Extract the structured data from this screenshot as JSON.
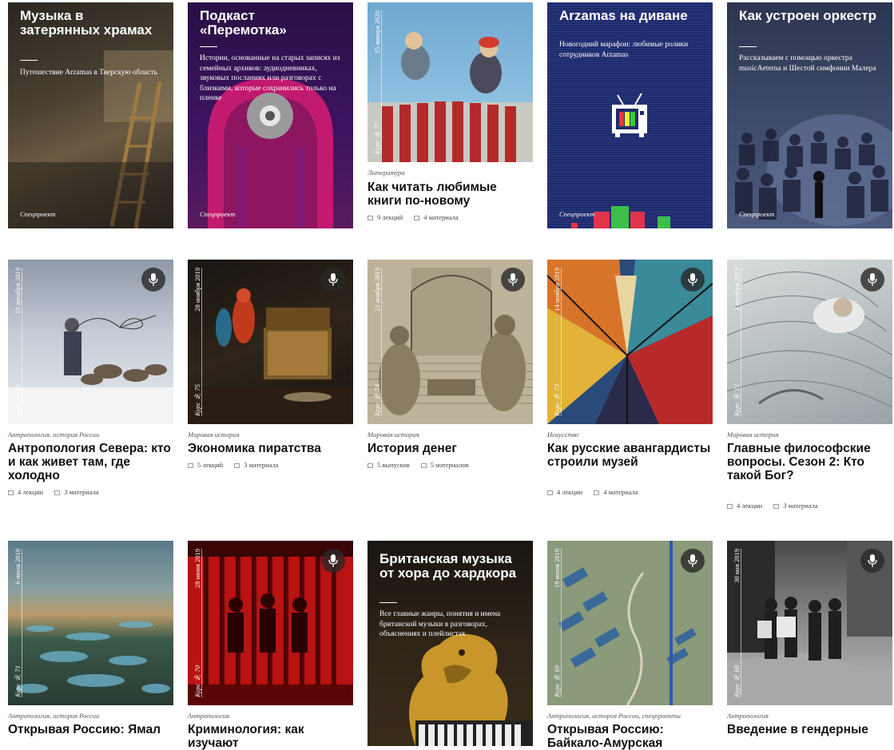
{
  "row1": [
    {
      "title": "Музыка в затерянных храмах",
      "desc": "Путешествие Arzamas в Тверскую область",
      "tag": "Спецпроект"
    },
    {
      "title": "Подкаст «Перемотка»",
      "desc": "Истории, основанные на старых записях из семейных архивов: аудиодневниках, звуковых посланиях или разговорах с близкими, которые сохранились только на пленке",
      "tag": "Спецпроект"
    },
    {
      "date": "15 января 2020",
      "num": "Курс № 77",
      "category": "Литература",
      "title": "Как читать любимые книги по-новому",
      "lectures": "9 лекций",
      "materials": "4 материала"
    },
    {
      "title": "Arzamas на диване",
      "desc": "Новогодний марафон: любимые ролики сотрудников Arzamas",
      "tag": "Спецпроект"
    },
    {
      "title": "Как устроен оркестр",
      "desc": "Рассказываем с помощью оркестра musicAeterna и Шестой симфонии Малера",
      "tag": "Спецпроект"
    }
  ],
  "row2": [
    {
      "date": "19 декабря 2019",
      "num": "Курс № 76",
      "category": "Антропология, история России",
      "title": "Антропология Севера: кто и как живет там, где холодно",
      "lectures": "4 лекции",
      "materials": "3 материала"
    },
    {
      "date": "28 ноября 2019",
      "num": "Курс № 75",
      "category": "Мировая история",
      "title": "Экономика пиратства",
      "lectures": "5 лекций",
      "materials": "3 материала"
    },
    {
      "date": "21 ноября 2019",
      "num": "Курс № 74",
      "category": "Мировая история",
      "title": "История денег",
      "lectures": "5 выпусков",
      "materials": "5 материалов"
    },
    {
      "date": "14 ноября 2019",
      "num": "Курс № 73",
      "category": "Искусство",
      "title": "Как русские авангардисты строили музей",
      "lectures": "4 лекции",
      "materials": "4 материала"
    },
    {
      "date": "3 октября 2019",
      "num": "Курс № 72",
      "category": "Мировая история",
      "title": "Главные философские вопросы. Сезон 2: Кто такой Бог?",
      "lectures": "4 лекции",
      "materials": "3 материала"
    }
  ],
  "row3": [
    {
      "date": "6 июля 2019",
      "num": "Курс № 71",
      "category": "Антропология, история России",
      "title": "Открывая Россию: Ямал"
    },
    {
      "date": "28 июня 2019",
      "num": "Курс № 70",
      "category": "Антропология",
      "title": "Криминология: как изучают"
    },
    {
      "title": "Британская музыка от хора до хардкора",
      "desc": "Все главные жанры, понятия и имена британской музыки в разговорах, объяснениях и плейлистах"
    },
    {
      "date": "18 июня 2019",
      "num": "Курс № 69",
      "category": "Антропология, история России, спецпроекты",
      "title": "Открывая Россию: Байкало-Амурская"
    },
    {
      "date": "30 мая 2019",
      "num": "Курс № 68",
      "category": "Антропология",
      "title": "Введение в гендерные"
    }
  ]
}
